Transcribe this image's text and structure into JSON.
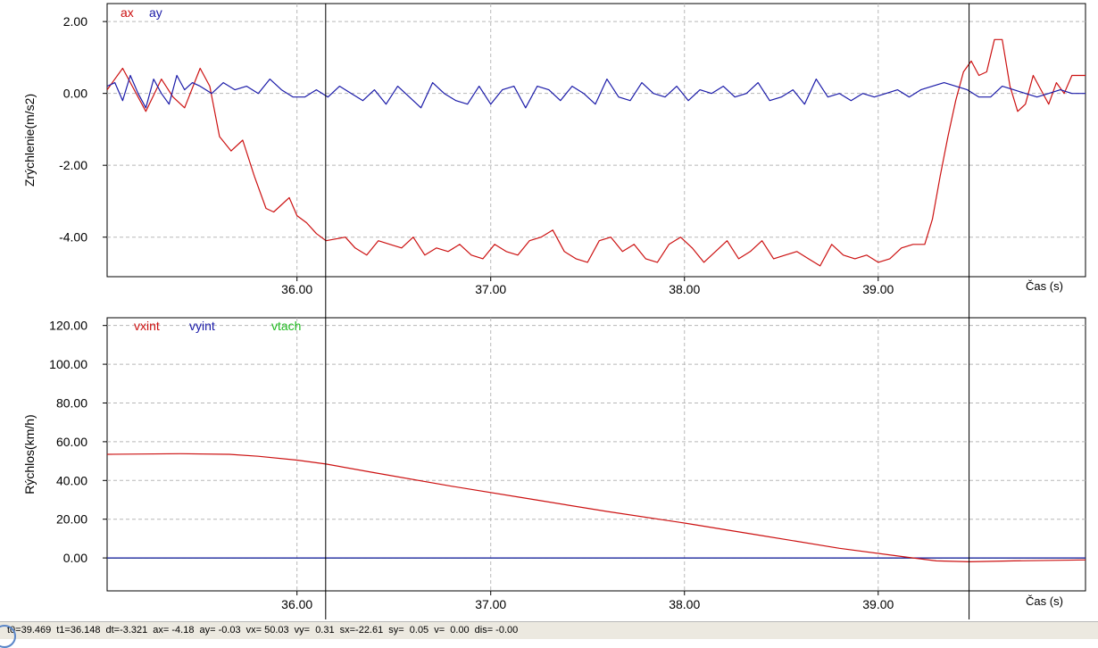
{
  "chart_data": [
    {
      "type": "line",
      "ylabel": "Zrýchlenie(m/s2)",
      "xlabel": "Čas (s)",
      "xlim": [
        35.02,
        40.07
      ],
      "ylim": [
        -5.1,
        2.5
      ],
      "xticks": [
        "36.00",
        "37.00",
        "38.00",
        "39.00"
      ],
      "yticks": [
        "2.00",
        "0.00",
        "-2.00",
        "-4.00"
      ],
      "grid": true,
      "legend_placement": "top-left",
      "cursors": [
        36.148,
        39.469
      ],
      "series": [
        {
          "name": "ax",
          "color": "#cc1111",
          "x": [
            35.02,
            35.1,
            35.15,
            35.22,
            35.3,
            35.36,
            35.42,
            35.5,
            35.55,
            35.6,
            35.66,
            35.72,
            35.78,
            35.84,
            35.88,
            35.92,
            35.96,
            36.0,
            36.05,
            36.1,
            36.15,
            36.2,
            36.25,
            36.3,
            36.36,
            36.42,
            36.48,
            36.54,
            36.6,
            36.66,
            36.72,
            36.78,
            36.84,
            36.9,
            36.96,
            37.02,
            37.08,
            37.14,
            37.2,
            37.26,
            37.32,
            37.38,
            37.44,
            37.5,
            37.56,
            37.62,
            37.68,
            37.74,
            37.8,
            37.86,
            37.92,
            37.98,
            38.04,
            38.1,
            38.16,
            38.22,
            38.28,
            38.34,
            38.4,
            38.46,
            38.52,
            38.58,
            38.64,
            38.7,
            38.76,
            38.82,
            38.88,
            38.94,
            39.0,
            39.06,
            39.12,
            39.18,
            39.24,
            39.28,
            39.32,
            39.36,
            39.4,
            39.44,
            39.48,
            39.52,
            39.56,
            39.6,
            39.64,
            39.68,
            39.72,
            39.76,
            39.8,
            39.84,
            39.88,
            39.92,
            39.96,
            40.0,
            40.07
          ],
          "y": [
            0.1,
            0.7,
            0.2,
            -0.5,
            0.4,
            -0.1,
            -0.4,
            0.7,
            0.2,
            -1.2,
            -1.6,
            -1.3,
            -2.3,
            -3.2,
            -3.3,
            -3.1,
            -2.9,
            -3.4,
            -3.6,
            -3.9,
            -4.1,
            -4.05,
            -4.0,
            -4.3,
            -4.5,
            -4.1,
            -4.2,
            -4.3,
            -4.0,
            -4.5,
            -4.3,
            -4.4,
            -4.2,
            -4.5,
            -4.6,
            -4.2,
            -4.4,
            -4.5,
            -4.1,
            -4.0,
            -3.8,
            -4.4,
            -4.6,
            -4.7,
            -4.1,
            -4.0,
            -4.4,
            -4.2,
            -4.6,
            -4.7,
            -4.2,
            -4.0,
            -4.3,
            -4.7,
            -4.4,
            -4.1,
            -4.6,
            -4.4,
            -4.1,
            -4.6,
            -4.5,
            -4.4,
            -4.6,
            -4.8,
            -4.2,
            -4.5,
            -4.6,
            -4.5,
            -4.7,
            -4.6,
            -4.3,
            -4.2,
            -4.2,
            -3.5,
            -2.3,
            -1.2,
            -0.2,
            0.6,
            0.9,
            0.5,
            0.6,
            1.5,
            1.5,
            0.2,
            -0.5,
            -0.3,
            0.5,
            0.1,
            -0.3,
            0.3,
            0.0,
            0.5,
            0.5
          ]
        },
        {
          "name": "ay",
          "color": "#1a1aa8",
          "x": [
            35.02,
            35.06,
            35.1,
            35.14,
            35.18,
            35.22,
            35.26,
            35.3,
            35.34,
            35.38,
            35.42,
            35.46,
            35.5,
            35.56,
            35.62,
            35.68,
            35.74,
            35.8,
            35.86,
            35.92,
            35.98,
            36.04,
            36.1,
            36.16,
            36.22,
            36.28,
            36.34,
            36.4,
            36.46,
            36.52,
            36.58,
            36.64,
            36.7,
            36.76,
            36.82,
            36.88,
            36.94,
            37.0,
            37.06,
            37.12,
            37.18,
            37.24,
            37.3,
            37.36,
            37.42,
            37.48,
            37.54,
            37.6,
            37.66,
            37.72,
            37.78,
            37.84,
            37.9,
            37.96,
            38.02,
            38.08,
            38.14,
            38.2,
            38.26,
            38.32,
            38.38,
            38.44,
            38.5,
            38.56,
            38.62,
            38.68,
            38.74,
            38.8,
            38.86,
            38.92,
            38.98,
            39.04,
            39.1,
            39.16,
            39.22,
            39.28,
            39.34,
            39.4,
            39.46,
            39.52,
            39.58,
            39.64,
            39.7,
            39.76,
            39.82,
            39.88,
            39.94,
            40.0,
            40.07
          ],
          "y": [
            0.2,
            0.3,
            -0.2,
            0.5,
            0.0,
            -0.4,
            0.4,
            0.0,
            -0.3,
            0.5,
            0.1,
            0.3,
            0.2,
            0.0,
            0.3,
            0.1,
            0.2,
            0.0,
            0.4,
            0.1,
            -0.1,
            -0.1,
            0.1,
            -0.1,
            0.2,
            0.0,
            -0.2,
            0.1,
            -0.3,
            0.2,
            -0.1,
            -0.4,
            0.3,
            0.0,
            -0.2,
            -0.3,
            0.2,
            -0.3,
            0.1,
            0.2,
            -0.4,
            0.2,
            0.1,
            -0.2,
            0.2,
            0.0,
            -0.3,
            0.4,
            -0.1,
            -0.2,
            0.3,
            0.0,
            -0.1,
            0.2,
            -0.2,
            0.1,
            0.0,
            0.2,
            -0.1,
            0.0,
            0.3,
            -0.2,
            -0.1,
            0.1,
            -0.3,
            0.4,
            -0.1,
            0.0,
            -0.2,
            0.0,
            -0.1,
            0.0,
            0.1,
            -0.1,
            0.1,
            0.2,
            0.3,
            0.2,
            0.1,
            -0.1,
            -0.1,
            0.2,
            0.1,
            0.0,
            -0.1,
            0.0,
            0.1,
            0.0,
            0.0
          ]
        }
      ]
    },
    {
      "type": "line",
      "ylabel": "Rýchlos(km/h)",
      "xlabel": "Čas (s)",
      "xlim": [
        35.02,
        40.07
      ],
      "ylim": [
        -17,
        124
      ],
      "xticks": [
        "36.00",
        "37.00",
        "38.00",
        "39.00"
      ],
      "yticks": [
        "120.00",
        "100.00",
        "80.00",
        "60.00",
        "40.00",
        "20.00",
        "0.00"
      ],
      "grid": true,
      "legend_placement": "top-left",
      "cursors": [
        36.148,
        39.469
      ],
      "series": [
        {
          "name": "vxint",
          "color": "#cc1111",
          "x": [
            35.02,
            35.4,
            35.65,
            35.8,
            36.0,
            36.15,
            36.4,
            36.8,
            37.2,
            37.6,
            38.0,
            38.4,
            38.8,
            39.1,
            39.3,
            39.47,
            39.7,
            40.07
          ],
          "y": [
            53.5,
            53.8,
            53.5,
            52.5,
            50.5,
            48.5,
            44.0,
            37.0,
            30.5,
            24.0,
            18.0,
            11.5,
            5.0,
            1.0,
            -1.5,
            -2.0,
            -1.5,
            -1.0
          ]
        },
        {
          "name": "vyint",
          "color": "#1a1aa8",
          "x": [
            35.02,
            40.07
          ],
          "y": [
            0.0,
            0.0
          ]
        },
        {
          "name": "vtach",
          "color": "#22bb22",
          "x": [
            35.02,
            40.07
          ],
          "y": [
            0.0,
            0.0
          ]
        }
      ]
    }
  ],
  "status": {
    "t0": "t0=39.469",
    "t1": "t1=36.148",
    "dt": "dt=-3.321",
    "ax": "ax= -4.18",
    "ay": "ay= -0.03",
    "vx": "vx= 50.03",
    "vy": "vy=  0.31",
    "sx": "sx=-22.61",
    "sy": "sy=  0.05",
    "v": "v=  0.00",
    "dis": "dis= -0.00"
  }
}
